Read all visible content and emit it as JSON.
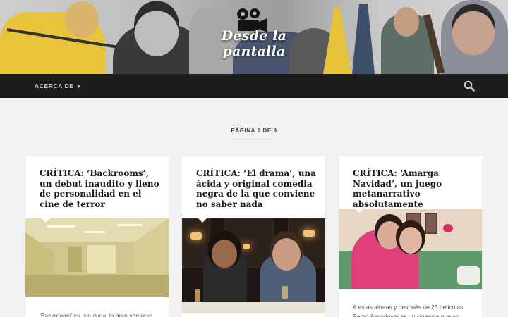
{
  "site": {
    "title": "Desde la pantalla",
    "logo_icon": "film-camera-icon"
  },
  "nav": {
    "about_label": "ACERCA DE",
    "about_caret_icon": "caret-down-icon",
    "search_icon": "search-icon"
  },
  "pagination": {
    "label": "PÁGINA 1 DE 9"
  },
  "posts": [
    {
      "title": "CRÍTICA: ‘Backrooms’, un debut inaudito y lleno de personalidad en el cine de terror",
      "excerpt": "‘Backrooms’ es, sin duda, la gran sorpresa"
    },
    {
      "title": "CRÍTICA: ‘El drama’, una ácida y original comedia negra de la que conviene no saber nada",
      "excerpt": ""
    },
    {
      "title": "CRÍTICA: ‘Amarga Navidad’, un juego metanarrativo absolutamente fascinante",
      "excerpt": "A estas alturas y después de 23 películas Pedro Almodóvar es un cineasta que no"
    }
  ]
}
